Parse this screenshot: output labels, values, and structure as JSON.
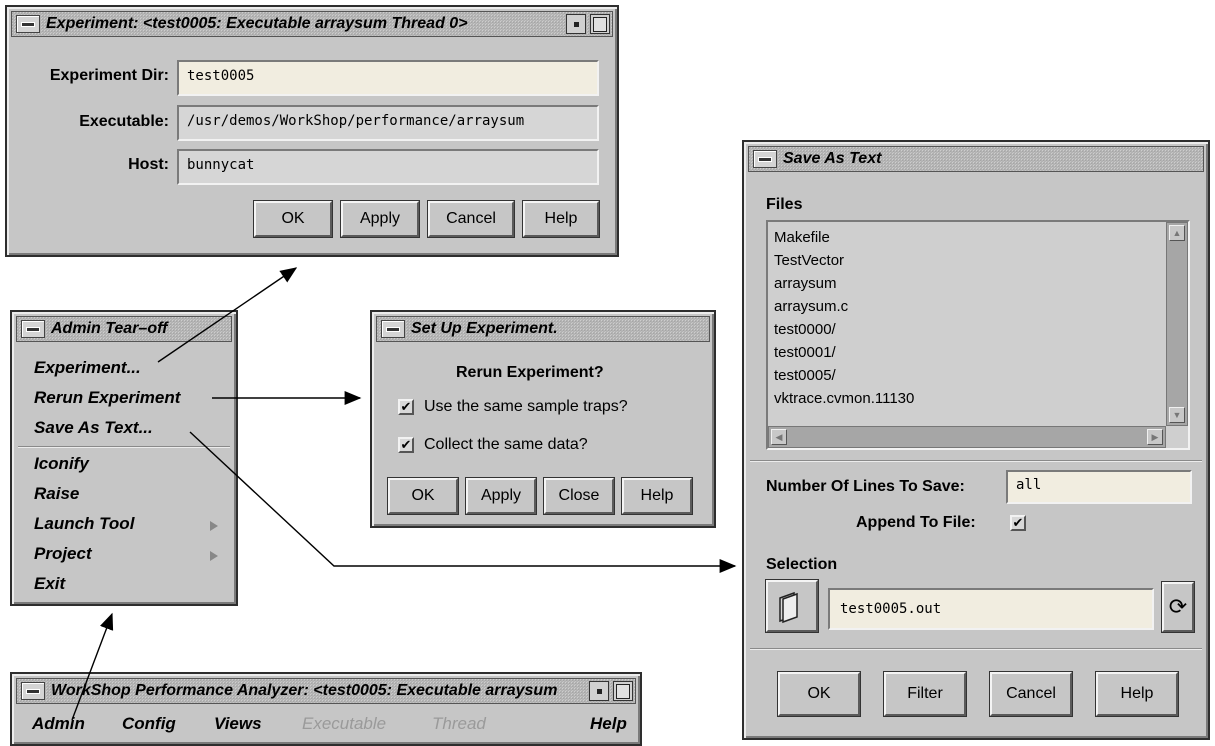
{
  "experiment_win": {
    "title": "Experiment: <test0005: Executable arraysum Thread 0>",
    "dir_label": "Experiment Dir:",
    "dir_value": "test0005",
    "exe_label": "Executable:",
    "exe_value": "/usr/demos/WorkShop/performance/arraysum",
    "host_label": "Host:",
    "host_value": "bunnycat",
    "ok": "OK",
    "apply": "Apply",
    "cancel": "Cancel",
    "help": "Help"
  },
  "admin_win": {
    "title": "Admin Tear–off",
    "items": [
      "Experiment...",
      "Rerun Experiment",
      "Save As Text...",
      "Iconify",
      "Raise",
      "Launch Tool",
      "Project",
      "Exit"
    ]
  },
  "setup_win": {
    "title": "Set Up Experiment.",
    "heading": "Rerun Experiment?",
    "opt1": "Use the same sample traps?",
    "opt2": "Collect the same data?",
    "ok": "OK",
    "apply": "Apply",
    "close": "Close",
    "help": "Help"
  },
  "save_win": {
    "title": "Save As Text",
    "files_label": "Files",
    "files": [
      "Makefile",
      "TestVector",
      "arraysum",
      "arraysum.c",
      "test0000/",
      "test0001/",
      "test0005/",
      "vktrace.cvmon.11130"
    ],
    "lines_label": "Number Of Lines To Save:",
    "lines_value": "all",
    "append_label": "Append To File:",
    "selection_label": "Selection",
    "selection_value": "test0005.out",
    "ok": "OK",
    "filter": "Filter",
    "cancel": "Cancel",
    "help": "Help"
  },
  "perf_win": {
    "title": "WorkShop Performance Analyzer: <test0005: Executable arraysum",
    "menu": [
      "Admin",
      "Config",
      "Views",
      "Executable",
      "Thread",
      "Help"
    ]
  },
  "colors": {
    "chrome": "#c6c6c6",
    "title": "#b3b3b3",
    "active_field": "#f1ede0"
  }
}
